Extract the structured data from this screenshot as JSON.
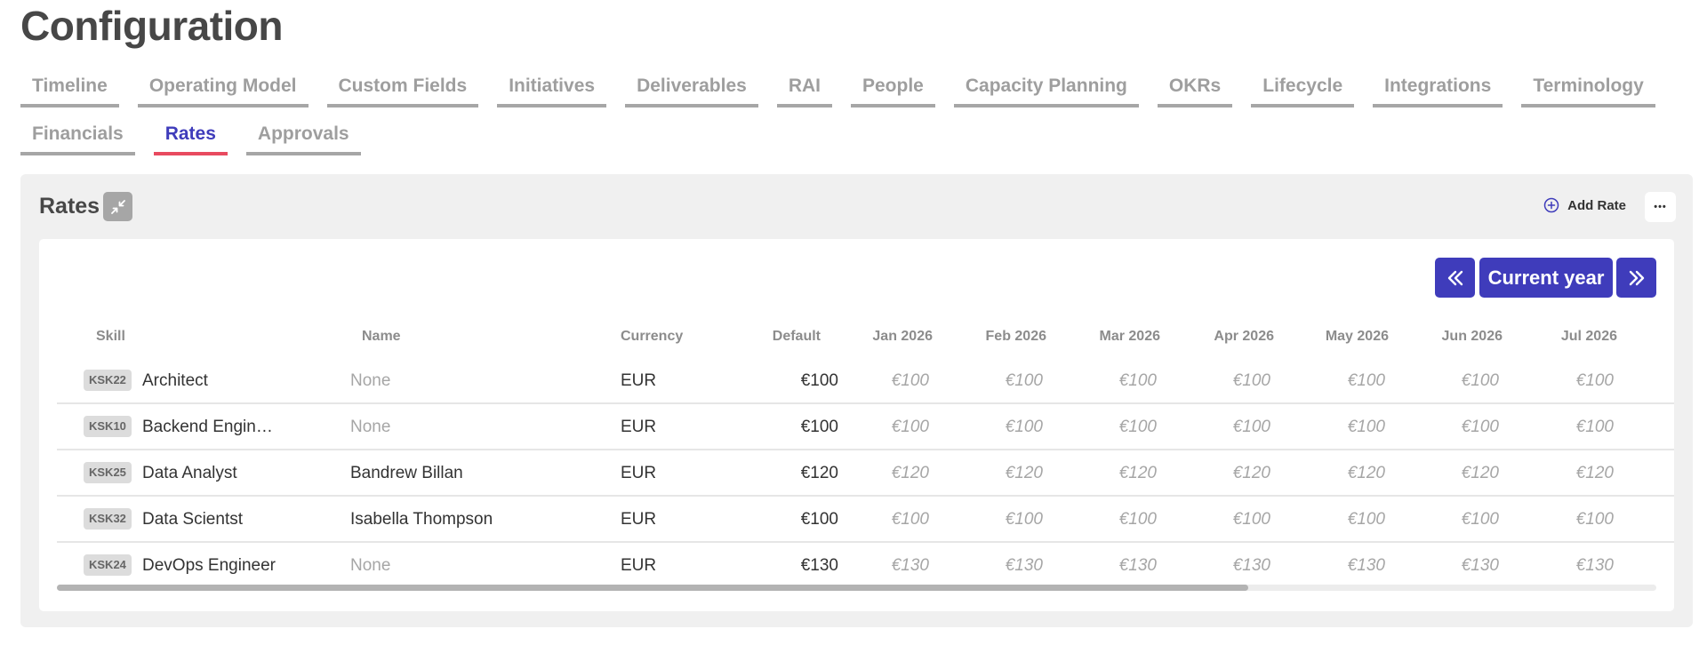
{
  "page": {
    "title": "Configuration"
  },
  "tabs_row1": [
    {
      "label": "Timeline",
      "active": false
    },
    {
      "label": "Operating Model",
      "active": false
    },
    {
      "label": "Custom Fields",
      "active": false
    },
    {
      "label": "Initiatives",
      "active": false
    },
    {
      "label": "Deliverables",
      "active": false
    },
    {
      "label": "RAI",
      "active": false
    },
    {
      "label": "People",
      "active": false
    },
    {
      "label": "Capacity Planning",
      "active": false
    },
    {
      "label": "OKRs",
      "active": false
    },
    {
      "label": "Lifecycle",
      "active": false
    },
    {
      "label": "Integrations",
      "active": false
    },
    {
      "label": "Terminology",
      "active": false
    }
  ],
  "tabs_row2": [
    {
      "label": "Financials",
      "active": false
    },
    {
      "label": "Rates",
      "active": true
    },
    {
      "label": "Approvals",
      "active": false
    }
  ],
  "panel": {
    "title": "Rates",
    "collapse_icon": "collapse-arrows-icon",
    "add_label": "Add Rate",
    "add_icon": "plus-circle-icon",
    "more_label": "•••"
  },
  "year_nav": {
    "prev_label": "«",
    "current_label": "Current year",
    "next_label": "»"
  },
  "table": {
    "columns": [
      "Skill",
      "Name",
      "Currency",
      "Default",
      "Jan 2026",
      "Feb 2026",
      "Mar 2026",
      "Apr 2026",
      "May 2026",
      "Jun 2026",
      "Jul 2026"
    ],
    "rows": [
      {
        "code": "KSK22",
        "skill": "Architect",
        "name": "None",
        "name_is_none": true,
        "currency": "EUR",
        "default": "€100",
        "months": [
          "€100",
          "€100",
          "€100",
          "€100",
          "€100",
          "€100",
          "€100"
        ]
      },
      {
        "code": "KSK10",
        "skill": "Backend Engin…",
        "name": "None",
        "name_is_none": true,
        "currency": "EUR",
        "default": "€100",
        "months": [
          "€100",
          "€100",
          "€100",
          "€100",
          "€100",
          "€100",
          "€100"
        ]
      },
      {
        "code": "KSK25",
        "skill": "Data Analyst",
        "name": "Bandrew Billan",
        "name_is_none": false,
        "currency": "EUR",
        "default": "€120",
        "months": [
          "€120",
          "€120",
          "€120",
          "€120",
          "€120",
          "€120",
          "€120"
        ]
      },
      {
        "code": "KSK32",
        "skill": "Data Scientst",
        "name": "Isabella Thompson",
        "name_is_none": false,
        "currency": "EUR",
        "default": "€100",
        "months": [
          "€100",
          "€100",
          "€100",
          "€100",
          "€100",
          "€100",
          "€100"
        ]
      },
      {
        "code": "KSK24",
        "skill": "DevOps Engineer",
        "name": "None",
        "name_is_none": true,
        "currency": "EUR",
        "default": "€130",
        "months": [
          "€130",
          "€130",
          "€130",
          "€130",
          "€130",
          "€130",
          "€130"
        ]
      }
    ]
  },
  "colors": {
    "accent": "#3f3cbb",
    "active_tab_underline": "#e84a5f",
    "muted_text": "#a6a6a6"
  }
}
